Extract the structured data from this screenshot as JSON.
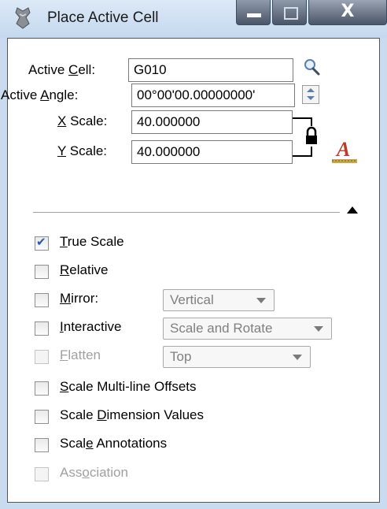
{
  "window": {
    "title": "Place Active Cell",
    "close_glyph": "X"
  },
  "fields": {
    "active_cell": {
      "label_pre": "Active ",
      "label_key": "C",
      "label_post": "ell:",
      "value": "G010"
    },
    "active_angle": {
      "label_pre": "Active ",
      "label_key": "A",
      "label_post": "ngle:",
      "value": "00°00'00.00000000'"
    },
    "x_scale": {
      "label_pre": "",
      "label_key": "X",
      "label_post": " Scale:",
      "value": "40.000000"
    },
    "y_scale": {
      "label_pre": "",
      "label_key": "Y",
      "label_post": " Scale:",
      "value": "40.000000"
    }
  },
  "options": {
    "true_scale": {
      "key": "T",
      "rest": "rue Scale",
      "checked": true,
      "enabled": true
    },
    "relative": {
      "key": "R",
      "rest": "elative",
      "checked": false,
      "enabled": true
    },
    "mirror": {
      "key": "M",
      "rest": "irror:",
      "checked": false,
      "enabled": true,
      "dropdown": "Vertical"
    },
    "interactive": {
      "key": "I",
      "rest": "nteractive",
      "checked": false,
      "enabled": true,
      "dropdown": "Scale and Rotate"
    },
    "flatten": {
      "key": "F",
      "rest": "latten",
      "checked": false,
      "enabled": false,
      "dropdown": "Top"
    },
    "scale_multiline": {
      "key": "S",
      "rest": "cale Multi-line Offsets",
      "checked": false,
      "enabled": true
    },
    "scale_dimension": {
      "pre": "Scale ",
      "key": "D",
      "rest": "imension Values",
      "checked": false,
      "enabled": true
    },
    "scale_annotations": {
      "pre": "Scal",
      "key": "e",
      "rest": " Annotations",
      "checked": false,
      "enabled": true
    },
    "association": {
      "pre": "Ass",
      "key": "o",
      "rest": "ciation",
      "checked": false,
      "enabled": false
    }
  },
  "icons": {
    "app": "microstation-app-icon",
    "search": "magnifier-icon",
    "lock": "padlock-icon",
    "text_style": "text-style-icon",
    "collapse": "collapse-arrow-icon"
  },
  "colors": {
    "accent": "#2a58a8",
    "frame": "#c9dcef",
    "disabled_text": "#a0a0a0"
  }
}
